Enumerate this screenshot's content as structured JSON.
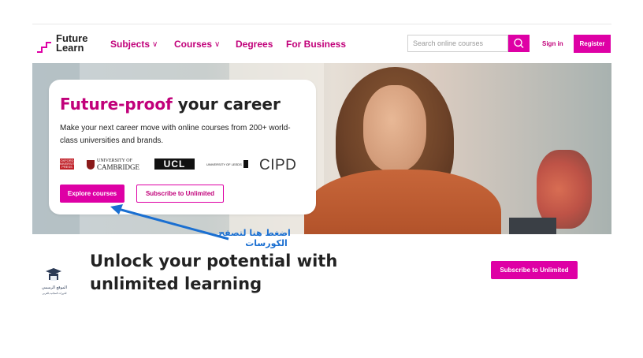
{
  "header": {
    "logo_text": [
      "Future",
      "Learn"
    ],
    "nav": [
      {
        "label": "Subjects",
        "has_dropdown": true
      },
      {
        "label": "Courses",
        "has_dropdown": true
      },
      {
        "label": "Degrees",
        "has_dropdown": false
      },
      {
        "label": "For Business",
        "has_dropdown": false
      }
    ],
    "search": {
      "placeholder": "Search online courses",
      "icon": "search-icon"
    },
    "sign_in": "Sign in",
    "register": "Register"
  },
  "hero": {
    "title_accent": "Future-proof",
    "title_rest": " your career",
    "description": "Make your next career move with online courses from 200+ world-class universities and brands.",
    "partners": {
      "oxford": "OXFORD UNIVERSITY PRESS",
      "cambridge": [
        "UNIVERSITY OF",
        "CAMBRIDGE"
      ],
      "ucl": "UCL",
      "leeds": "UNIVERSITY OF LEEDS",
      "cipd": "CIPD"
    },
    "explore_button": "Explore courses",
    "subscribe_button": "Subscribe to Unlimited"
  },
  "annotation": {
    "line1": "اضغط هنا لتصفح",
    "line2": "الكورسات",
    "color": "#1a6fd1"
  },
  "promo": {
    "title": "Unlock your potential with unlimited learning",
    "button": "Subscribe to Unlimited",
    "watermark": [
      "الموقع الرسمي",
      "للدورات المجانية بالعربي"
    ]
  },
  "colors": {
    "accent": "#de00a5",
    "accent_text": "#c1007a"
  }
}
